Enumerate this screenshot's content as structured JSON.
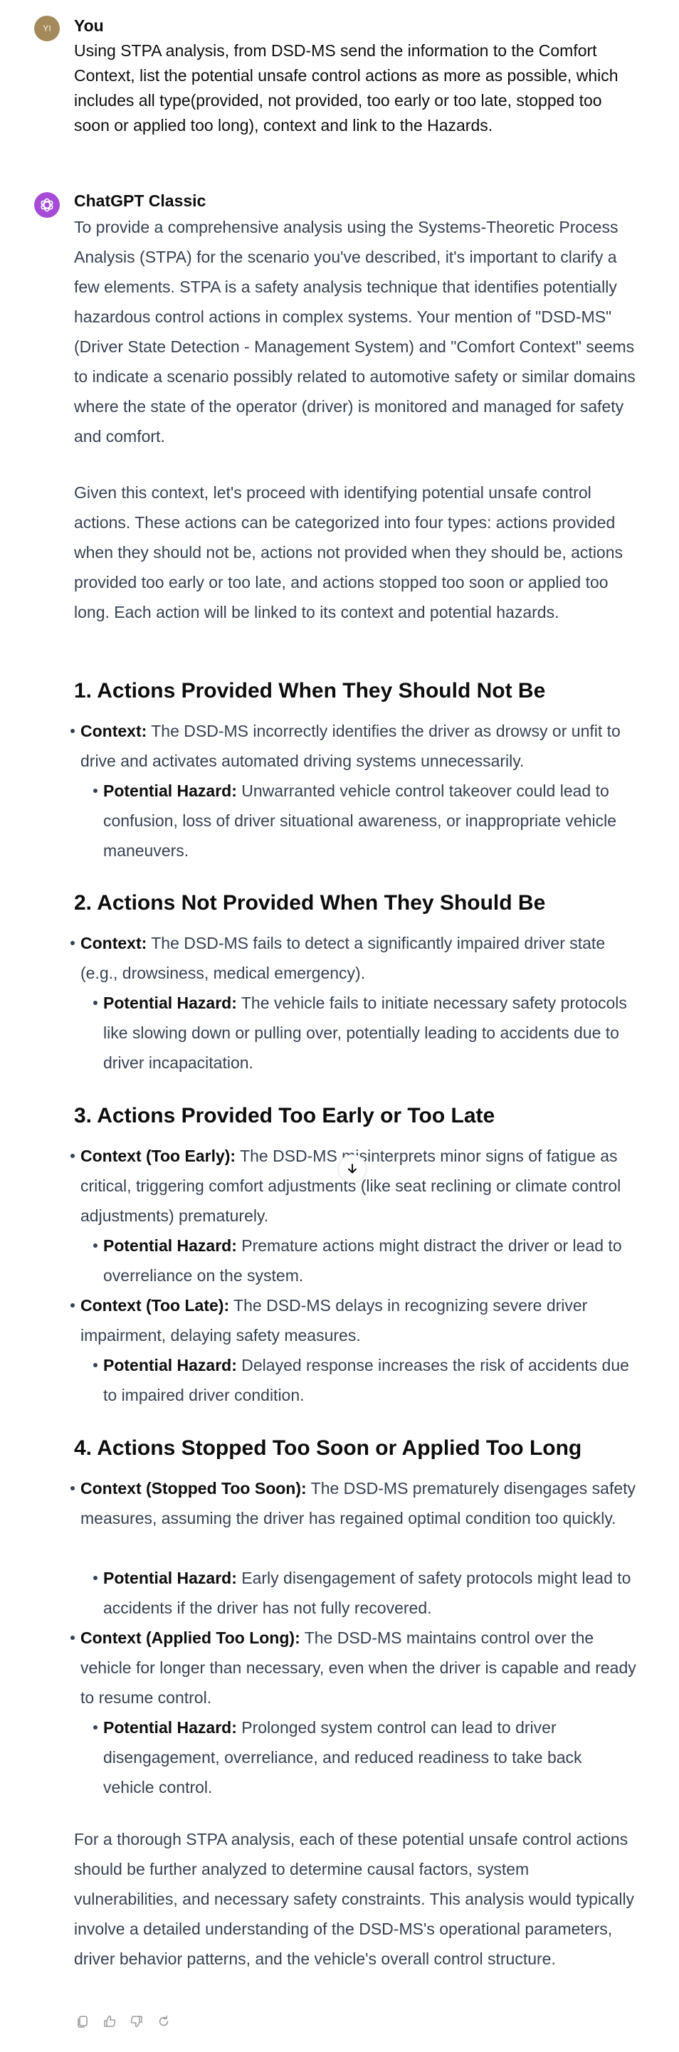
{
  "user_message": {
    "avatar_initials": "YI",
    "author": "You",
    "text": "Using STPA analysis, from DSD-MS send the information to the Comfort Context, list the potential unsafe control actions as more as possible, which includes all type(provided, not provided, too early or too late, stopped too soon or applied too long), context and link to the Hazards."
  },
  "assistant_message": {
    "author": "ChatGPT Classic",
    "intro_1": "To provide a comprehensive analysis using the Systems-Theoretic Process Analysis (STPA) for the scenario you've described, it's important to clarify a few elements. STPA is a safety analysis technique that identifies potentially hazardous control actions in complex systems. Your mention of \"DSD-MS\" (Driver State Detection - Management System) and \"Comfort Context\" seems to indicate a scenario possibly related to automotive safety or similar domains where the state of the operator (driver) is monitored and managed for safety and comfort.",
    "intro_2": "Given this context, let's proceed with identifying potential unsafe control actions. These actions can be categorized into four types: actions provided when they should not be, actions not provided when they should be, actions provided too early or too late, and actions stopped too soon or applied too long. Each action will be linked to its context and potential hazards.",
    "sections": [
      {
        "heading": "1. Actions Provided When They Should Not Be",
        "items": [
          {
            "context_label": "Context:",
            "context_text": " The DSD-MS incorrectly identifies the driver as drowsy or unfit to drive and activates automated driving systems unnecessarily.",
            "hazard_label": "Potential Hazard:",
            "hazard_text": " Unwarranted vehicle control takeover could lead to confusion, loss of driver situational awareness, or inappropriate vehicle maneuvers."
          }
        ]
      },
      {
        "heading": "2. Actions Not Provided When They Should Be",
        "items": [
          {
            "context_label": "Context:",
            "context_text": " The DSD-MS fails to detect a significantly impaired driver state (e.g., drowsiness, medical emergency).",
            "hazard_label": "Potential Hazard:",
            "hazard_text": " The vehicle fails to initiate necessary safety protocols like slowing down or pulling over, potentially leading to accidents due to driver incapacitation."
          }
        ]
      },
      {
        "heading": "3. Actions Provided Too Early or Too Late",
        "items": [
          {
            "context_label": "Context (Too Early):",
            "context_text": " The DSD-MS misinterprets minor signs of fatigue as critical, triggering comfort adjustments (like seat reclining or climate control adjustments) prematurely.",
            "hazard_label": "Potential Hazard:",
            "hazard_text": " Premature actions might distract the driver or lead to overreliance on the system."
          },
          {
            "context_label": "Context (Too Late):",
            "context_text": " The DSD-MS delays in recognizing severe driver impairment, delaying safety measures.",
            "hazard_label": "Potential Hazard:",
            "hazard_text": " Delayed response increases the risk of accidents due to impaired driver condition."
          }
        ]
      },
      {
        "heading": "4. Actions Stopped Too Soon or Applied Too Long",
        "items": [
          {
            "context_label": "Context (Stopped Too Soon):",
            "context_text": " The DSD-MS prematurely disengages safety measures, assuming the driver has regained optimal condition too quickly.",
            "hazard_label": "Potential Hazard:",
            "hazard_text": " Early disengagement of safety protocols might lead to accidents if the driver has not fully recovered."
          },
          {
            "context_label": "Context (Applied Too Long):",
            "context_text": " The DSD-MS maintains control over the vehicle for longer than necessary, even when the driver is capable and ready to resume control.",
            "hazard_label": "Potential Hazard:",
            "hazard_text": " Prolonged system control can lead to driver disengagement, overreliance, and reduced readiness to take back vehicle control."
          }
        ]
      }
    ],
    "conclusion": "For a thorough STPA analysis, each of these potential unsafe control actions should be further analyzed to determine causal factors, system vulnerabilities, and necessary safety constraints. This analysis would typically involve a detailed understanding of the DSD-MS's operational parameters, driver behavior patterns, and the vehicle's overall control structure."
  },
  "icons": {
    "scroll_down": "arrow-down-icon",
    "copy": "copy-icon",
    "thumbs_up": "thumbs-up-icon",
    "thumbs_down": "thumbs-down-icon",
    "regenerate": "regenerate-icon"
  },
  "colors": {
    "user_avatar": "#a48a5a",
    "assistant_avatar": "#a54bd6",
    "text": "#374151",
    "heading": "#0d0d0d"
  }
}
